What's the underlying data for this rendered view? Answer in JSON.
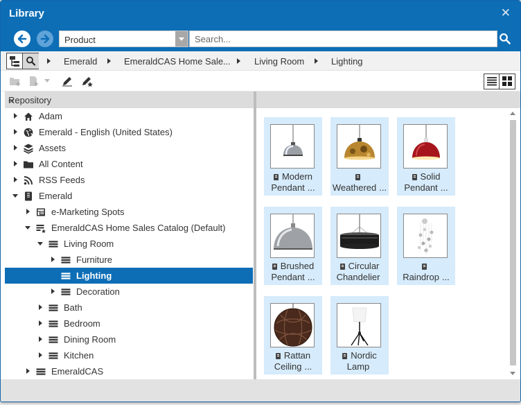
{
  "window": {
    "title": "Library",
    "close_label": "✕"
  },
  "nav": {
    "content_type": "Product",
    "search_placeholder": "Search..."
  },
  "breadcrumb": [
    "Emerald",
    "EmeraldCAS Home Sale...",
    "Living Room",
    "Lighting"
  ],
  "repository": {
    "title": "Repository",
    "collapse_icon": "«",
    "items": [
      {
        "label": "Adam",
        "icon": "home-icon",
        "level": 0,
        "state": "closed"
      },
      {
        "label": "Emerald - English (United States)",
        "icon": "globe-icon",
        "level": 0,
        "state": "closed"
      },
      {
        "label": "Assets",
        "icon": "assets-icon",
        "level": 0,
        "state": "closed"
      },
      {
        "label": "All Content",
        "icon": "folder-icon",
        "level": 0,
        "state": "closed"
      },
      {
        "label": "RSS Feeds",
        "icon": "rss-icon",
        "level": 0,
        "state": "closed"
      },
      {
        "label": "Emerald",
        "icon": "store-icon",
        "level": 0,
        "state": "open"
      },
      {
        "label": "e-Marketing Spots",
        "icon": "espot-icon",
        "level": 1,
        "state": "closed"
      },
      {
        "label": "EmeraldCAS Home Sales Catalog (Default)",
        "icon": "catalog-icon",
        "level": 1,
        "state": "open"
      },
      {
        "label": "Living Room",
        "icon": "category-icon",
        "level": 2,
        "state": "open"
      },
      {
        "label": "Furniture",
        "icon": "category-icon",
        "level": 3,
        "state": "closed"
      },
      {
        "label": "Lighting",
        "icon": "category-icon",
        "level": 3,
        "state": "none",
        "selected": true
      },
      {
        "label": "Decoration",
        "icon": "category-icon",
        "level": 3,
        "state": "closed"
      },
      {
        "label": "Bath",
        "icon": "category-icon",
        "level": 2,
        "state": "closed"
      },
      {
        "label": "Bedroom",
        "icon": "category-icon",
        "level": 2,
        "state": "closed"
      },
      {
        "label": "Dining Room",
        "icon": "category-icon",
        "level": 2,
        "state": "closed"
      },
      {
        "label": "Kitchen",
        "icon": "category-icon",
        "level": 2,
        "state": "closed"
      },
      {
        "label": "EmeraldCAS",
        "icon": "category-icon",
        "level": 1,
        "state": "closed"
      }
    ]
  },
  "products": [
    {
      "line1": "Modern",
      "line2": "Pendant",
      "more": "...",
      "image": "modern-pendant"
    },
    {
      "line1": "",
      "line2": "Weathered",
      "more": "...",
      "image": "weathered-pendant"
    },
    {
      "line1": "Solid",
      "line2": "Pendant",
      "more": "...",
      "image": "solid-pendant"
    },
    {
      "line1": "Brushed",
      "line2": "Pendant",
      "more": "...",
      "image": "brushed-pendant"
    },
    {
      "line1": "Circular",
      "line2": "Chandelier",
      "more": "",
      "image": "circular-chandelier"
    },
    {
      "line1": "",
      "line2": "Raindrop",
      "more": "...",
      "image": "raindrop"
    },
    {
      "line1": "Rattan",
      "line2": "Ceiling",
      "more": "...",
      "image": "rattan-ceiling"
    },
    {
      "line1": "Nordic",
      "line2": "Lamp",
      "more": "",
      "image": "nordic-lamp"
    }
  ],
  "colors": {
    "accent": "#0d6eb6",
    "selection": "#0d6eb6",
    "tile": "#d6ebfb"
  }
}
